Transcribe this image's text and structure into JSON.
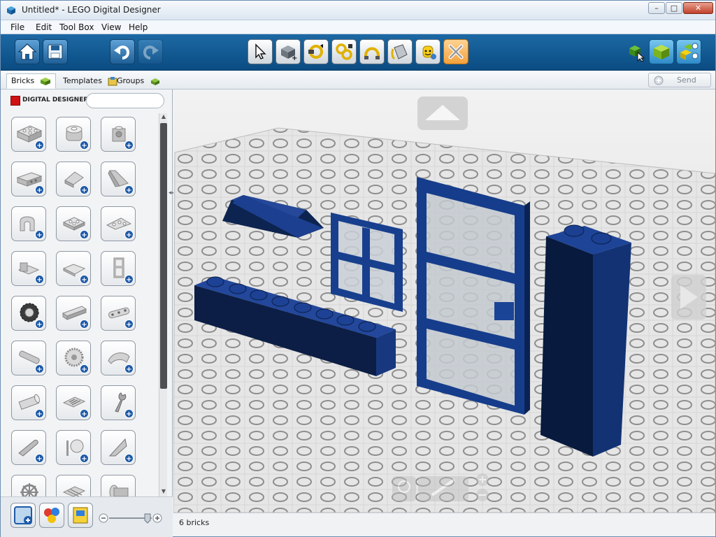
{
  "window": {
    "title": "Untitled* - LEGO Digital Designer",
    "minimize": "–",
    "maximize": "□",
    "close": "✕"
  },
  "menu": [
    "File",
    "Edit",
    "Tool Box",
    "View",
    "Help"
  ],
  "toolbar": {
    "left_icons": [
      "home-icon",
      "save-icon",
      "undo-icon",
      "redo-icon"
    ],
    "center_icons": [
      "select-cursor-icon",
      "clone-icon",
      "hinge-icon",
      "flex-icon",
      "hinge-align-icon",
      "paint-icon",
      "minifig-icon",
      "delete-icon"
    ],
    "right_icons": [
      "build-mode-icon",
      "view-mode-icon",
      "building-guide-icon"
    ]
  },
  "tabs": [
    {
      "label": "Bricks",
      "icon": "brick-icon"
    },
    {
      "label": "Templates",
      "icon": "templates-icon"
    },
    {
      "label": "Groups",
      "icon": "groups-icon"
    }
  ],
  "send_label": "Send",
  "palette": {
    "logo": "DIGITAL DESIGNER",
    "search_placeholder": "",
    "collapse": "◂◂"
  },
  "status": "6 bricks",
  "colors": {
    "toolbar": "#0f5a93",
    "brick_blue": "#1f4fa0",
    "active_tool": "#f2a13c"
  }
}
